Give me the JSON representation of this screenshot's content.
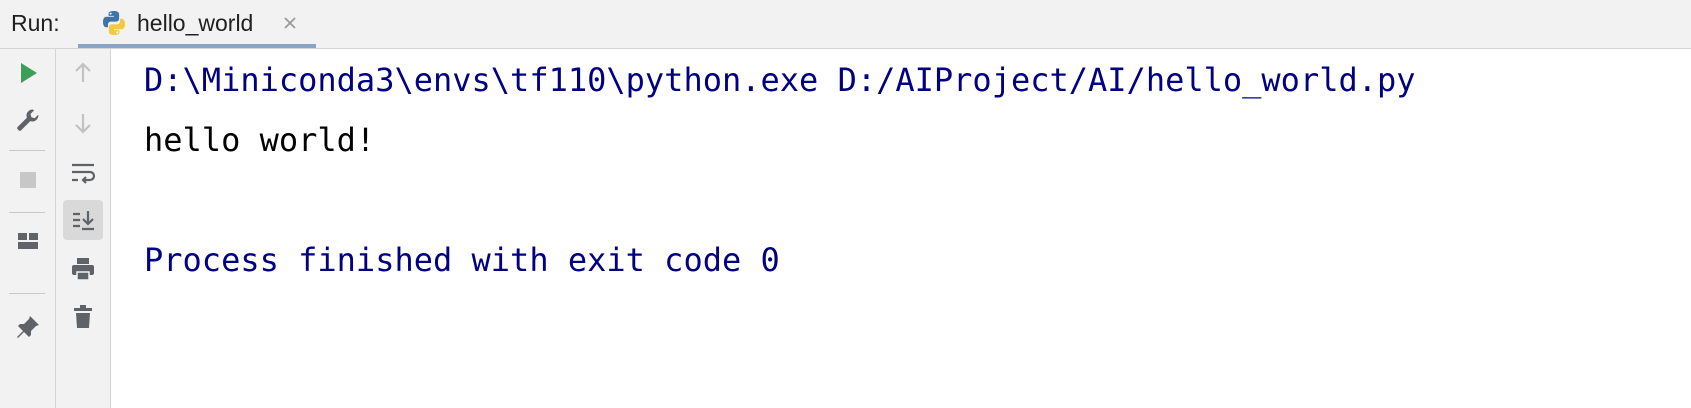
{
  "run_panel": {
    "label": "Run:",
    "tab": {
      "title": "hello_world",
      "icon": "python-icon",
      "close_icon": "close-icon"
    }
  },
  "left_toolbar": {
    "items": [
      {
        "icon": "run-icon",
        "color": "#3d9e57"
      },
      {
        "icon": "wrench-icon"
      },
      {
        "icon": "stop-icon",
        "disabled": true
      },
      {
        "icon": "layout-icon"
      },
      {
        "icon": "pin-icon"
      }
    ]
  },
  "console_toolbar": {
    "items": [
      {
        "icon": "arrow-up-icon",
        "disabled": true
      },
      {
        "icon": "arrow-down-icon",
        "disabled": true
      },
      {
        "icon": "soft-wrap-icon"
      },
      {
        "icon": "scroll-to-end-icon",
        "active": true
      },
      {
        "icon": "print-icon"
      },
      {
        "icon": "trash-icon"
      }
    ]
  },
  "console": {
    "command": "D:\\Miniconda3\\envs\\tf110\\python.exe D:/AIProject/AI/hello_world.py",
    "output": "hello world!",
    "exit_message": "Process finished with exit code 0",
    "colors": {
      "system_text": "#000080",
      "stdout_text": "#000000"
    }
  }
}
